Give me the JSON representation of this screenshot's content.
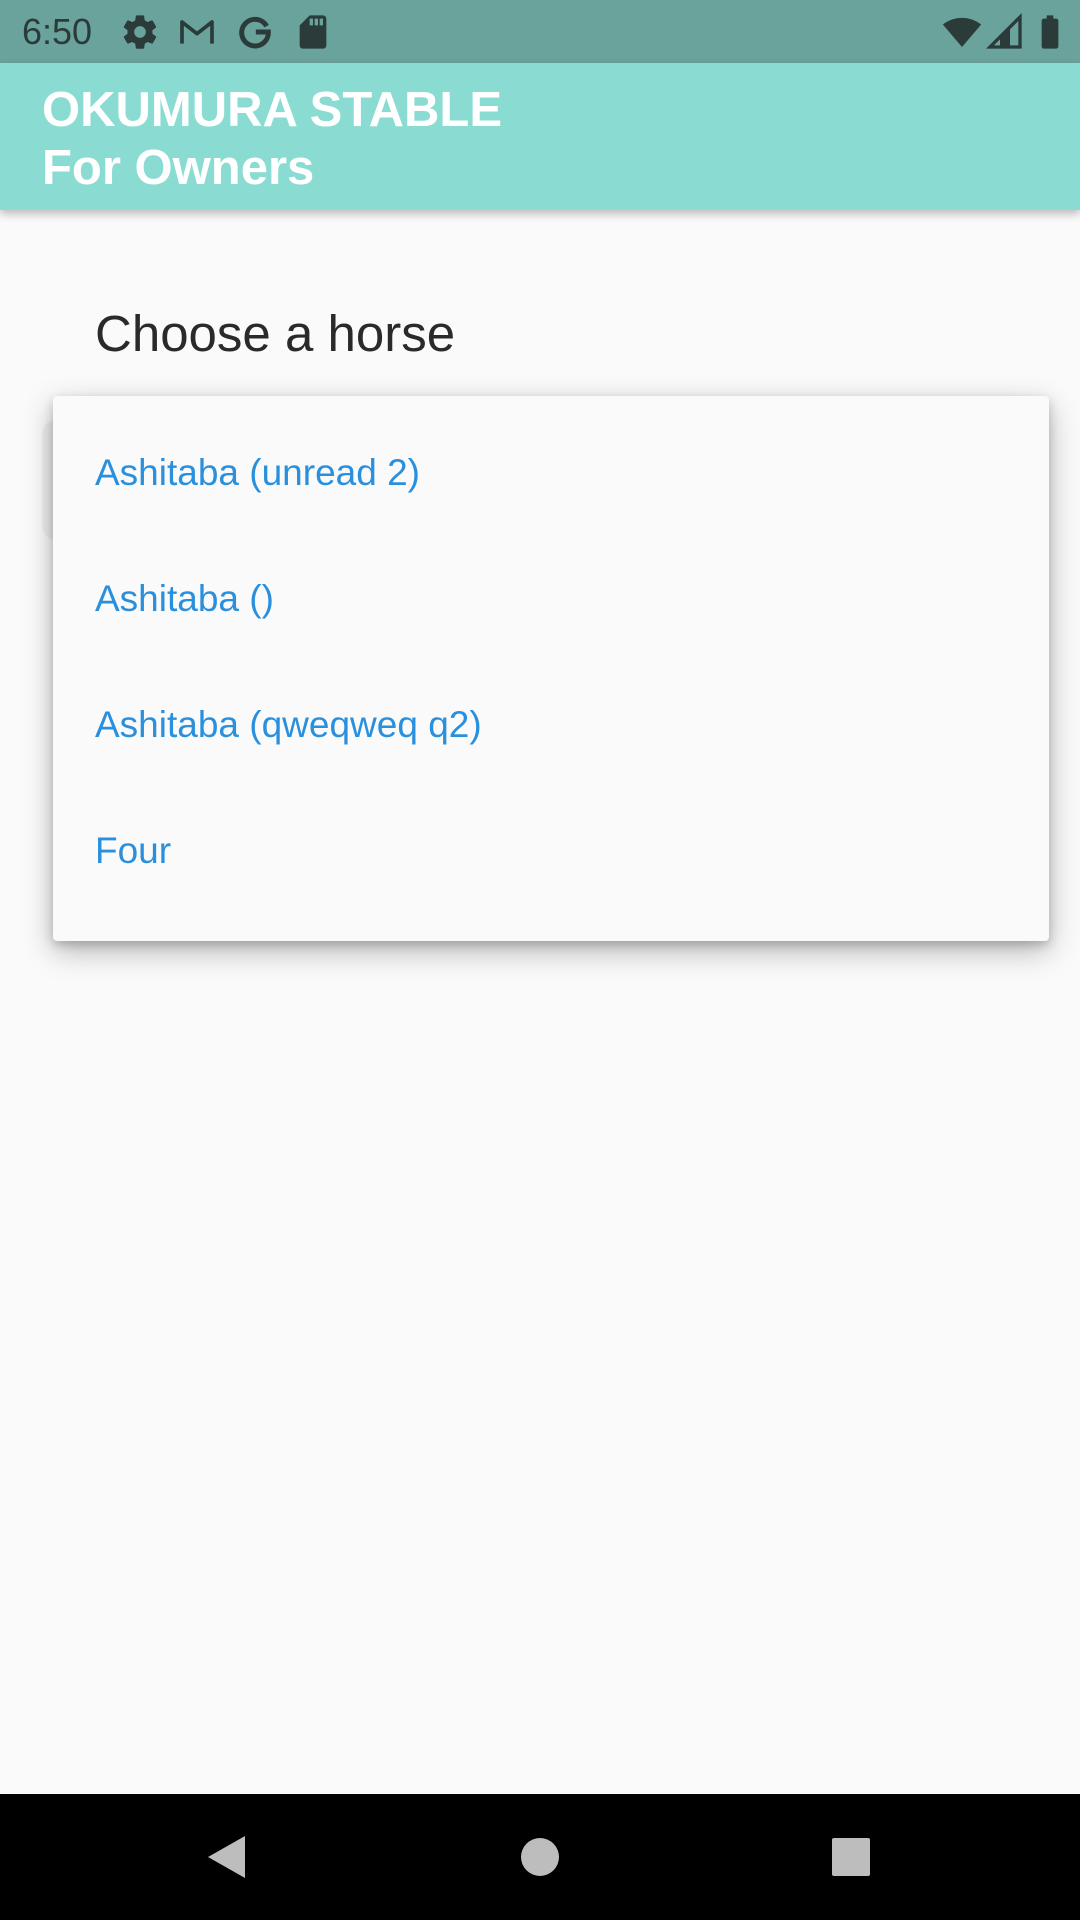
{
  "status_bar": {
    "time": "6:50",
    "left_icons": [
      "gear-icon",
      "gmail-icon",
      "google-icon",
      "sd-card-icon"
    ],
    "right_icons": [
      "wifi-icon",
      "signal-icon",
      "battery-icon"
    ],
    "color": "#6aa39b"
  },
  "app_bar": {
    "title": "OKUMURA STABLE\nFor Owners",
    "color": "#8adcd2"
  },
  "page": {
    "heading": "Choose a horse"
  },
  "dropdown": {
    "items": [
      {
        "label": "Ashitaba (unread 2)"
      },
      {
        "label": "Ashitaba ()"
      },
      {
        "label": "Ashitaba (qweqweq q2)"
      },
      {
        "label": "Four"
      }
    ],
    "item_color": "#2a90dd"
  },
  "nav_bar": {
    "buttons": [
      "back-icon",
      "home-icon",
      "recents-icon"
    ]
  }
}
